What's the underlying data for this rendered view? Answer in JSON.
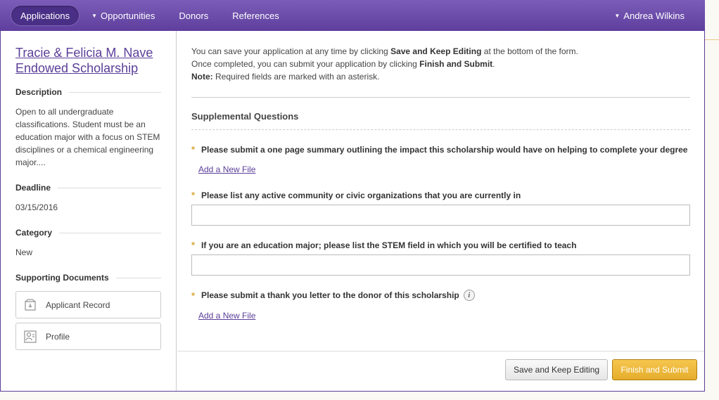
{
  "nav": {
    "applications": "Applications",
    "opportunities": "Opportunities",
    "donors": "Donors",
    "references": "References",
    "user": "Andrea Wilkins"
  },
  "sidebar": {
    "title_line1": "Tracie & Felicia M. Nave",
    "title_line2": "Endowed Scholarship",
    "description_label": "Description",
    "description_text": "Open to all undergraduate classifications. Student must be an education major with a focus on STEM disciplines or a chemical engineering major....",
    "deadline_label": "Deadline",
    "deadline_value": "03/15/2016",
    "category_label": "Category",
    "category_value": "New",
    "supporting_label": "Supporting Documents",
    "docs": [
      {
        "label": "Applicant Record",
        "icon": "record-icon"
      },
      {
        "label": "Profile",
        "icon": "profile-icon"
      }
    ]
  },
  "intro": {
    "line1_pre": "You can save your application at any time by clicking ",
    "line1_bold": "Save and Keep Editing",
    "line1_post": " at the bottom of the form.",
    "line2_pre": "Once completed, you can submit your application by clicking ",
    "line2_bold": "Finish and Submit",
    "line2_post": ".",
    "note_bold": "Note:",
    "note_text": " Required fields are marked with an asterisk."
  },
  "supplemental": {
    "heading": "Supplemental Questions",
    "q1": "Please submit a one page summary outlining the impact this scholarship would have on helping to complete your degree",
    "q1_link": "Add a New File",
    "q2": "Please list any active community or civic organizations that you are currently in",
    "q2_value": "",
    "q3": "If you are an education major; please list the STEM field in which you will be certified to teach",
    "q3_value": "",
    "q4": "Please submit a thank you letter to the donor of this scholarship",
    "q4_link": "Add a New File",
    "required_marker": "*"
  },
  "footer": {
    "save_label": "Save and Keep Editing",
    "finish_label": "Finish and Submit"
  },
  "colors": {
    "nav_purple": "#5f3f9d",
    "link_purple": "#5b3e99",
    "required_star": "#d9a63b",
    "finish_button": "#e5ad2c"
  }
}
